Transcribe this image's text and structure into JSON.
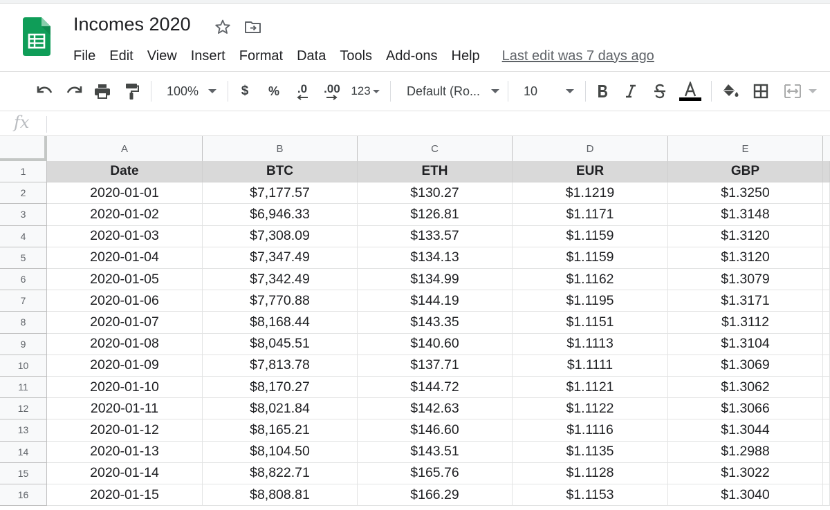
{
  "document": {
    "title": "Incomes 2020",
    "last_edit": "Last edit was 7 days ago"
  },
  "menu": [
    "File",
    "Edit",
    "View",
    "Insert",
    "Format",
    "Data",
    "Tools",
    "Add-ons",
    "Help"
  ],
  "toolbar": {
    "zoom": "100%",
    "currency": "$",
    "percent": "%",
    "decimal_decrease": ".0",
    "decimal_increase": ".00",
    "more_formats": "123",
    "font": "Default (Ro...",
    "font_size": "10",
    "text_color": "#000000",
    "icons": [
      "undo-icon",
      "redo-icon",
      "print-icon",
      "paint-format-icon",
      "bold-icon",
      "italic-icon",
      "strikethrough-icon",
      "text-color-icon",
      "fill-color-icon",
      "borders-icon",
      "merge-cells-icon"
    ]
  },
  "formula_bar": {
    "fx": "fx",
    "value": ""
  },
  "sheet": {
    "columns": [
      "A",
      "B",
      "C",
      "D",
      "E"
    ],
    "header_fill": "#d9d9d9",
    "rows": [
      {
        "num": "1",
        "cells": [
          "Date",
          "BTC",
          "ETH",
          "EUR",
          "GBP"
        ]
      },
      {
        "num": "2",
        "cells": [
          "2020-01-01",
          "$7,177.57",
          "$130.27",
          "$1.1219",
          "$1.3250"
        ]
      },
      {
        "num": "3",
        "cells": [
          "2020-01-02",
          "$6,946.33",
          "$126.81",
          "$1.1171",
          "$1.3148"
        ]
      },
      {
        "num": "4",
        "cells": [
          "2020-01-03",
          "$7,308.09",
          "$133.57",
          "$1.1159",
          "$1.3120"
        ]
      },
      {
        "num": "5",
        "cells": [
          "2020-01-04",
          "$7,347.49",
          "$134.13",
          "$1.1159",
          "$1.3120"
        ]
      },
      {
        "num": "6",
        "cells": [
          "2020-01-05",
          "$7,342.49",
          "$134.99",
          "$1.1162",
          "$1.3079"
        ]
      },
      {
        "num": "7",
        "cells": [
          "2020-01-06",
          "$7,770.88",
          "$144.19",
          "$1.1195",
          "$1.3171"
        ]
      },
      {
        "num": "8",
        "cells": [
          "2020-01-07",
          "$8,168.44",
          "$143.35",
          "$1.1151",
          "$1.3112"
        ]
      },
      {
        "num": "9",
        "cells": [
          "2020-01-08",
          "$8,045.51",
          "$140.60",
          "$1.1113",
          "$1.3104"
        ]
      },
      {
        "num": "10",
        "cells": [
          "2020-01-09",
          "$7,813.78",
          "$137.71",
          "$1.1111",
          "$1.3069"
        ]
      },
      {
        "num": "11",
        "cells": [
          "2020-01-10",
          "$8,170.27",
          "$144.72",
          "$1.1121",
          "$1.3062"
        ]
      },
      {
        "num": "12",
        "cells": [
          "2020-01-11",
          "$8,021.84",
          "$142.63",
          "$1.1122",
          "$1.3066"
        ]
      },
      {
        "num": "13",
        "cells": [
          "2020-01-12",
          "$8,165.21",
          "$146.60",
          "$1.1116",
          "$1.3044"
        ]
      },
      {
        "num": "14",
        "cells": [
          "2020-01-13",
          "$8,104.50",
          "$143.51",
          "$1.1135",
          "$1.2988"
        ]
      },
      {
        "num": "15",
        "cells": [
          "2020-01-14",
          "$8,822.71",
          "$165.76",
          "$1.1128",
          "$1.3022"
        ]
      },
      {
        "num": "16",
        "cells": [
          "2020-01-15",
          "$8,808.81",
          "$166.29",
          "$1.1153",
          "$1.3040"
        ]
      }
    ]
  }
}
